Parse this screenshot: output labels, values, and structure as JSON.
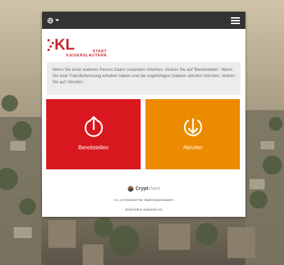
{
  "topbar": {
    "language_icon": "globe-icon",
    "menu_icon": "hamburger-menu-icon"
  },
  "logo": {
    "mark": "KL",
    "line1": "STADT",
    "line2": "KAISERSLAUTERN"
  },
  "info": {
    "text": "Wenn Sie einer anderen Person Daten zusenden möchten, klicken Sie auf 'Bereitstellen'. Wenn Sie eine Transferkennung erhalten haben und die zugehörigen Dateien abrufen möchten, klicken Sie auf 'Abrufen'."
  },
  "tiles": {
    "provide": {
      "label": "Bereitstellen",
      "icon": "upload-icon",
      "color": "#d9171e"
    },
    "retrieve": {
      "label": "Abrufen",
      "icon": "download-icon",
      "color": "#ec8a00"
    }
  },
  "footer": {
    "brand_main": "Crypt",
    "brand_sub": "share",
    "license": "4.1.1.0 lizenziert für Stadt Kaiserslautern",
    "copyright": "2018 befine Solutions AG"
  }
}
